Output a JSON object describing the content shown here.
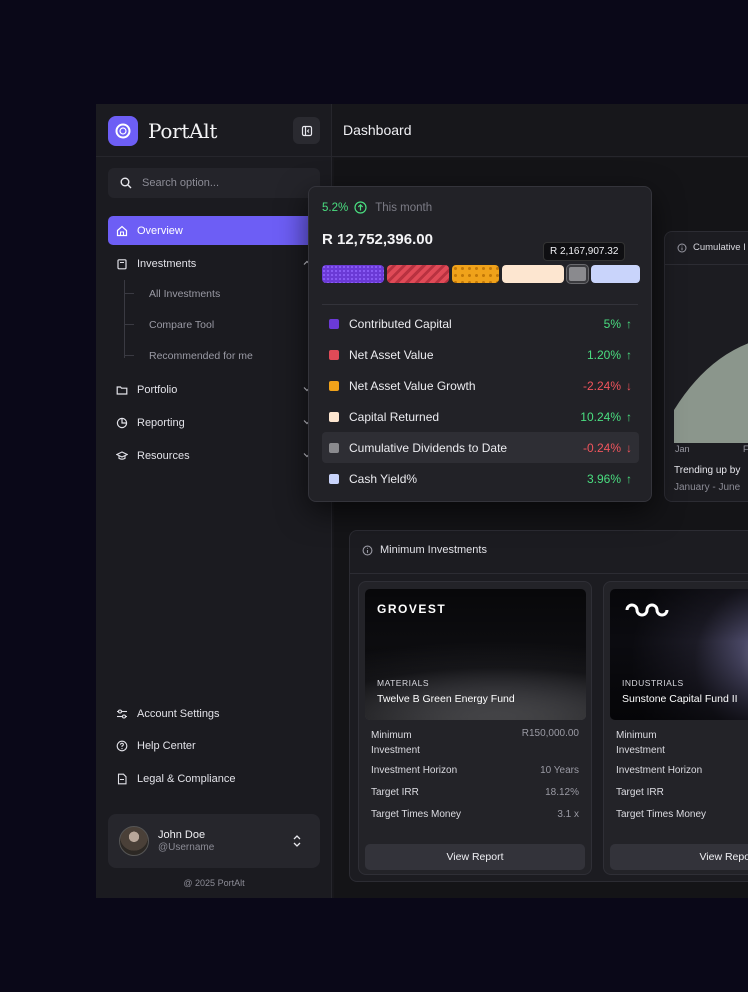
{
  "app": {
    "name": "PortAlt",
    "page_title": "Dashboard"
  },
  "search": {
    "placeholder": "Search option..."
  },
  "sidebar": {
    "items": [
      {
        "label": "Overview",
        "icon": "home-icon"
      },
      {
        "label": "Investments",
        "icon": "clipboard-icon"
      },
      {
        "label": "Portfolio",
        "icon": "folder-icon"
      },
      {
        "label": "Reporting",
        "icon": "pie-chart-icon"
      },
      {
        "label": "Resources",
        "icon": "graduation-cap-icon"
      }
    ],
    "investments_sub": [
      "All Investments",
      "Compare Tool",
      "Recommended for me"
    ],
    "bottom": [
      {
        "label": "Account Settings",
        "icon": "sliders-icon"
      },
      {
        "label": "Help Center",
        "icon": "help-circle-icon"
      },
      {
        "label": "Legal & Compliance",
        "icon": "document-icon"
      }
    ]
  },
  "user": {
    "name": "John Doe",
    "handle": "@Username"
  },
  "footer": {
    "copyright": "@ 2025 PortAlt"
  },
  "summary": {
    "change_pct": "5.2%",
    "period": "This month",
    "total": "R 12,752,396.00",
    "tooltip": "R 2,167,907.32",
    "segments": [
      {
        "name": "Contributed Capital",
        "share": 0.205
      },
      {
        "name": "Net Asset Value",
        "share": 0.205
      },
      {
        "name": "Net Asset Value Growth",
        "share": 0.155
      },
      {
        "name": "Capital Returned",
        "share": 0.205
      },
      {
        "name": "Cumulative Dividends to Date",
        "share": 0.068
      },
      {
        "name": "Cash Yield%",
        "share": 0.127
      }
    ],
    "legend": [
      {
        "label": "Contributed Capital",
        "value": "5%",
        "trend": "up",
        "color": "#6b3ad6"
      },
      {
        "label": "Net Asset Value",
        "value": "1.20%",
        "trend": "up",
        "color": "#e04a57"
      },
      {
        "label": "Net Asset Value Growth",
        "value": "-2.24%",
        "trend": "down",
        "color": "#f0a21a"
      },
      {
        "label": "Capital Returned",
        "value": "10.24%",
        "trend": "up",
        "color": "#fde6d0"
      },
      {
        "label": "Cumulative Dividends to Date",
        "value": "-0.24%",
        "trend": "down",
        "color": "#8a8a8e"
      },
      {
        "label": "Cash Yield%",
        "value": "3.96%",
        "trend": "up",
        "color": "#c9d4fb"
      }
    ]
  },
  "cumulative_card": {
    "title": "Cumulative I",
    "x_labels": [
      "Jan",
      "F"
    ],
    "footer_title": "Trending up by",
    "footer_sub": "January - June"
  },
  "min_investments": {
    "title": "Minimum Investments",
    "funds": [
      {
        "logo": "GROVEST",
        "category": "MATERIALS",
        "name": "Twelve B Green Energy Fund",
        "rows": [
          {
            "label": "Minimum Investment",
            "value": "R150,000.00"
          },
          {
            "label": "Investment Horizon",
            "value": "10 Years"
          },
          {
            "label": "Target IRR",
            "value": "18.12%"
          },
          {
            "label": "Target Times Money",
            "value": "3.1 x"
          }
        ],
        "button": "View Report"
      },
      {
        "logo": "infinity-logo",
        "category": "INDUSTRIALS",
        "name": "Sunstone Capital Fund II",
        "rows": [
          {
            "label": "Minimum Investment",
            "value": ""
          },
          {
            "label": "Investment Horizon",
            "value": ""
          },
          {
            "label": "Target IRR",
            "value": ""
          },
          {
            "label": "Target Times Money",
            "value": ""
          }
        ],
        "button": "View Report"
      }
    ]
  }
}
